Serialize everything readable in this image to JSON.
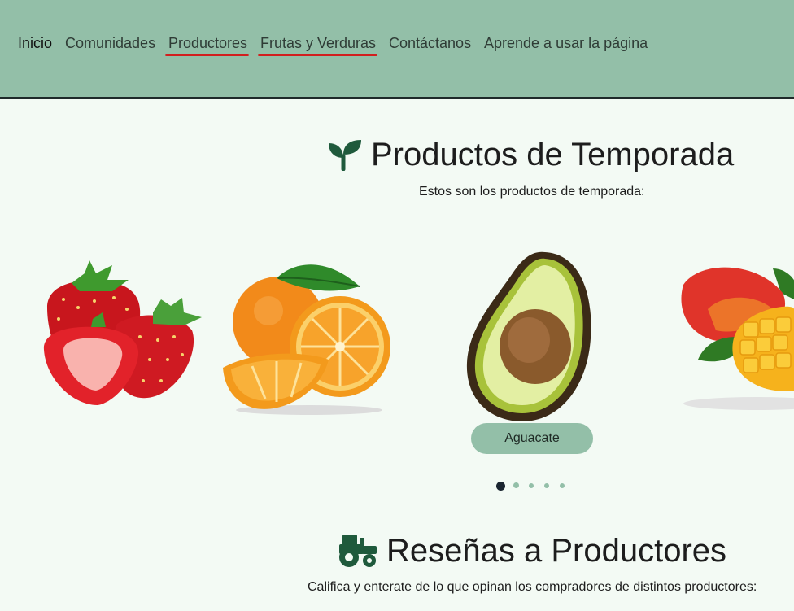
{
  "nav": {
    "items": [
      {
        "label": "Inicio"
      },
      {
        "label": "Comunidades"
      },
      {
        "label": "Productores"
      },
      {
        "label": "Frutas y Verduras"
      },
      {
        "label": "Contáctanos"
      },
      {
        "label": "Aprende a usar la página"
      }
    ]
  },
  "seasonal": {
    "icon": "sprout-icon",
    "title": "Productos de Temporada",
    "subtitle": "Estos son los productos de temporada:",
    "current_label": "Aguacate",
    "carousel": {
      "slides": 5,
      "active_index": 0
    },
    "products": [
      "strawberry",
      "orange",
      "avocado",
      "mango"
    ]
  },
  "reviews": {
    "icon": "tractor-icon",
    "title": "Reseñas a Productores",
    "subtitle": "Califica y enterate de lo que opinan los compradores de distintos productores:"
  },
  "colors": {
    "nav_background": "#93bfa8",
    "page_background": "#f3faf4",
    "highlight_underline": "#d21e1e",
    "icon_green": "#1f5a3c"
  }
}
